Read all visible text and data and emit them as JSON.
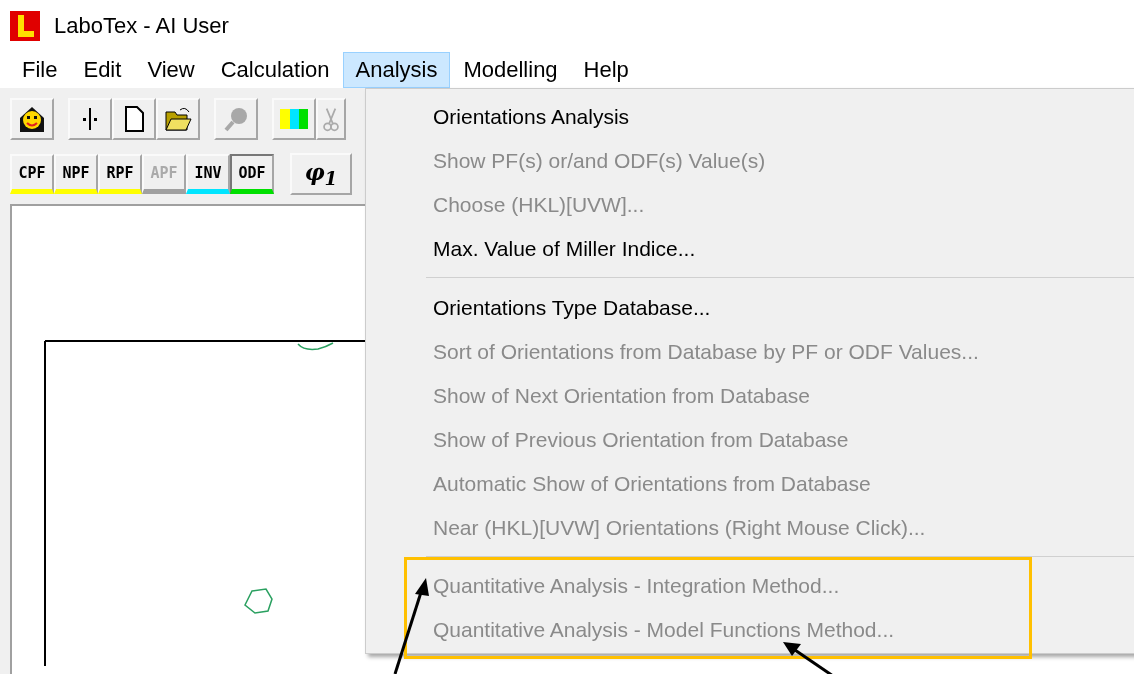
{
  "window": {
    "title": "LaboTex - AI User"
  },
  "menubar": [
    {
      "label": "File",
      "selected": false
    },
    {
      "label": "Edit",
      "selected": false
    },
    {
      "label": "View",
      "selected": false
    },
    {
      "label": "Calculation",
      "selected": false
    },
    {
      "label": "Analysis",
      "selected": true
    },
    {
      "label": "Modelling",
      "selected": false
    },
    {
      "label": "Help",
      "selected": false
    }
  ],
  "toolbar_icons": [
    {
      "kind": "face",
      "disabled": false
    },
    {
      "kind": "divider",
      "disabled": false
    },
    {
      "kind": "document",
      "disabled": false
    },
    {
      "kind": "folder",
      "disabled": false
    },
    {
      "kind": "magnifier",
      "disabled": true
    },
    {
      "kind": "colors",
      "disabled": false
    },
    {
      "kind": "scissors",
      "disabled": true
    }
  ],
  "figure_buttons": [
    {
      "label": "CPF",
      "color": "#ffff00",
      "disabled": false,
      "selected": false
    },
    {
      "label": "NPF",
      "color": "#ffff00",
      "disabled": false,
      "selected": false
    },
    {
      "label": "RPF",
      "color": "#ffff00",
      "disabled": false,
      "selected": false
    },
    {
      "label": "APF",
      "color": "#a0a0a0",
      "disabled": true,
      "selected": false
    },
    {
      "label": "INV",
      "color": "#00e5ff",
      "disabled": false,
      "selected": false
    },
    {
      "label": "ODF",
      "color": "#00e000",
      "disabled": false,
      "selected": true
    }
  ],
  "angle_button": {
    "label": "φ$_{1}$"
  },
  "analysis_menu": [
    {
      "label": "Orientations Analysis",
      "disabled": false,
      "highlighted": false
    },
    {
      "label": "Show PF(s) or/and ODF(s)  Value(s)",
      "disabled": true,
      "highlighted": false
    },
    {
      "label": "Choose (HKL)[UVW]...",
      "disabled": true,
      "highlighted": false
    },
    {
      "label": "Max. Value of Miller Indice...",
      "disabled": false,
      "highlighted": false
    },
    {
      "kind": "separator"
    },
    {
      "label": "Orientations Type Database...",
      "disabled": false,
      "highlighted": false
    },
    {
      "label": "Sort of Orientations from Database by PF or ODF Values...",
      "disabled": true,
      "highlighted": false
    },
    {
      "label": "Show of Next Orientation from Database",
      "disabled": true,
      "highlighted": false
    },
    {
      "label": "Show of Previous Orientation from Database",
      "disabled": true,
      "highlighted": false
    },
    {
      "label": "Automatic Show of Orientations from Database",
      "disabled": true,
      "highlighted": false
    },
    {
      "label": "Near (HKL)[UVW] Orientations (Right Mouse Click)...",
      "disabled": true,
      "highlighted": false
    },
    {
      "kind": "separator"
    },
    {
      "label": "Quantitative Analysis - Integration Method...",
      "disabled": true,
      "highlighted": true
    },
    {
      "label": "Quantitative Analysis - Model Functions Method...",
      "disabled": true,
      "highlighted": true
    }
  ]
}
